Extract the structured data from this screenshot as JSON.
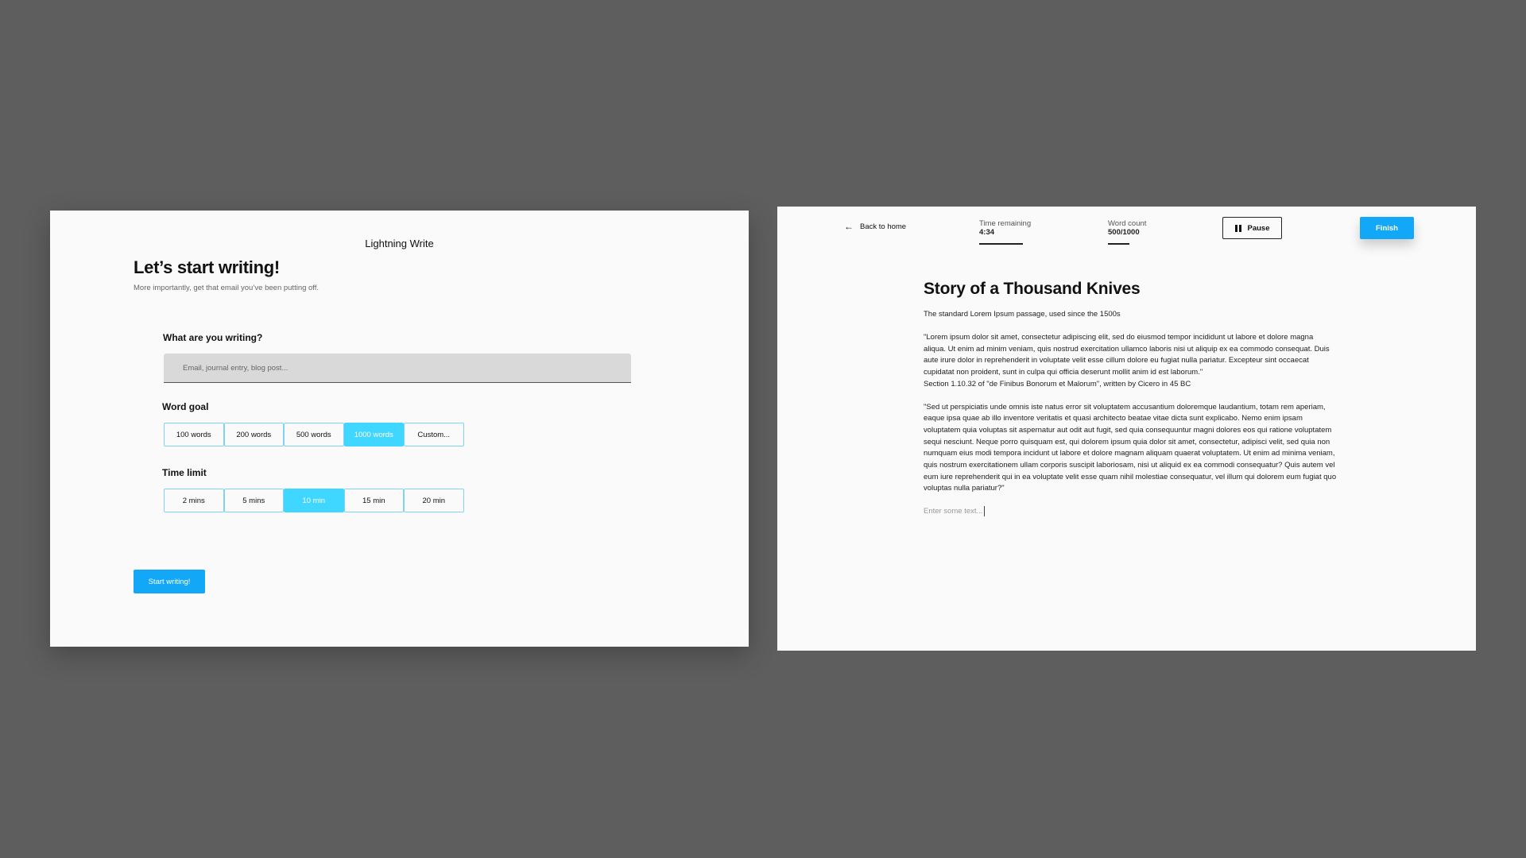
{
  "setup": {
    "app_title": "Lightning Write",
    "heading": "Let’s start writing!",
    "subtitle": "More importantly, get that email you’ve been putting off.",
    "question_label": "What are you writing?",
    "question_placeholder": "Email, journal entry, blog post...",
    "question_value": "",
    "word_goal": {
      "label": "Word goal",
      "options": [
        "100 words",
        "200 words",
        "500 words",
        "1000 words",
        "Custom..."
      ],
      "selected": "1000 words"
    },
    "time_limit": {
      "label": "Time limit",
      "options": [
        "2 mins",
        "5 mins",
        "10 min",
        "15 min",
        "20 min"
      ],
      "selected": "10 min"
    },
    "start_label": "Start writing!"
  },
  "writer": {
    "back_label": "Back to home",
    "back_icon": "arrow-left-icon",
    "time_remaining": {
      "label": "Time remaining",
      "value": "4:34"
    },
    "word_count": {
      "label": "Word count",
      "value": "500/1000"
    },
    "pause_label": "Pause",
    "pause_icon": "pause-icon",
    "finish_label": "Finish",
    "doc_title": "Story of a Thousand Knives",
    "doc_subtitle": "The standard Lorem Ipsum passage, used since the 1500s",
    "paragraphs": [
      "\"Lorem ipsum dolor sit amet, consectetur adipiscing elit, sed do eiusmod tempor incididunt ut labore et dolore magna aliqua. Ut enim ad minim veniam, quis nostrud exercitation ullamco laboris nisi ut aliquip ex ea commodo consequat. Duis aute irure dolor in reprehenderit in voluptate velit esse cillum dolore eu fugiat nulla pariatur. Excepteur sint occaecat cupidatat non proident, sunt in culpa qui officia deserunt mollit anim id est laborum.\"\nSection 1.10.32 of \"de Finibus Bonorum et Malorum\", written by Cicero in 45 BC",
      "\"Sed ut perspiciatis unde omnis iste natus error sit voluptatem accusantium doloremque laudantium, totam rem aperiam, eaque ipsa quae ab illo inventore veritatis et quasi architecto beatae vitae dicta sunt explicabo. Nemo enim ipsam voluptatem quia voluptas sit aspernatur aut odit aut fugit, sed quia consequuntur magni dolores eos qui ratione voluptatem sequi nesciunt. Neque porro quisquam est, qui dolorem ipsum quia dolor sit amet, consectetur, adipisci velit, sed quia non numquam eius modi tempora incidunt ut labore et dolore magnam aliquam quaerat voluptatem. Ut enim ad minima veniam, quis nostrum exercitationem ullam corporis suscipit laboriosam, nisi ut aliquid ex ea commodi consequatur? Quis autem vel eum iure reprehenderit qui in ea voluptate velit esse quam nihil molestiae consequatur, vel illum qui dolorem eum fugiat quo voluptas nulla pariatur?\""
    ],
    "editor_placeholder": "Enter some text..."
  },
  "colors": {
    "background": "#5e5e5e",
    "panel": "#fafafa",
    "primary": "#12a8f7",
    "selected": "#3fd7ff",
    "segment_border": "#7fd3f2"
  }
}
